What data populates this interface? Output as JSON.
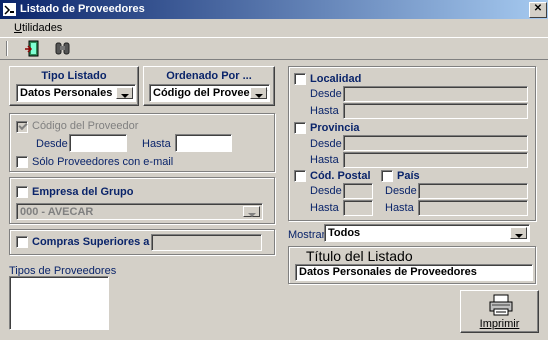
{
  "window": {
    "title": "Listado de Proveedores"
  },
  "menu": {
    "utilidades": "Utilidades"
  },
  "toolbar": {
    "exit_icon": "exit-door-icon",
    "search_icon": "binoculars-icon"
  },
  "tipo_listado": {
    "label": "Tipo Listado",
    "value": "Datos Personales"
  },
  "ordenado_por": {
    "label": "Ordenado Por ...",
    "value": "Código del Proveedor"
  },
  "codigo": {
    "label": "Código del Proveedor",
    "desde": "Desde",
    "hasta": "Hasta",
    "email_label": "Sólo Proveedores con e-mail"
  },
  "empresa": {
    "label": "Empresa del Grupo",
    "value": "000 - AVECAR"
  },
  "compras": {
    "label": "Compras Superiores a ..."
  },
  "tipos_proveedores": {
    "label": "Tipos de Proveedores"
  },
  "localidad": {
    "label": "Localidad",
    "desde": "Desde",
    "hasta": "Hasta"
  },
  "provincia": {
    "label": "Provincia",
    "desde": "Desde",
    "hasta": "Hasta"
  },
  "cod_postal": {
    "label": "Cód. Postal",
    "desde": "Desde",
    "hasta": "Hasta"
  },
  "pais": {
    "label": "País",
    "desde": "Desde",
    "hasta": "Hasta"
  },
  "mostrar": {
    "label": "Mostrar",
    "value": "Todos"
  },
  "titulo_listado": {
    "label": "Título del Listado",
    "value": "Datos Personales de Proveedores"
  },
  "imprimir": {
    "label": "Imprimir",
    "icon": "printer-icon"
  }
}
